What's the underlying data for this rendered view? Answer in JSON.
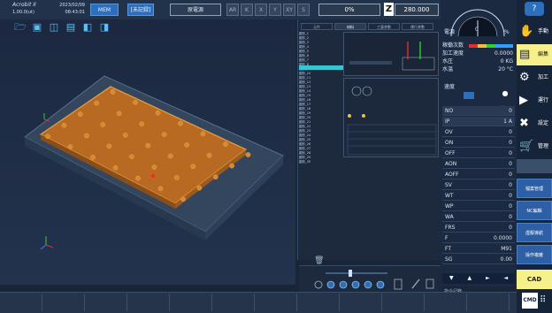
{
  "header": {
    "logo": "Acrobit II",
    "logo_sub": "1.00.0(ut)",
    "date": "2023/02/09",
    "time": "08:43:01",
    "mode_btn": "MEM",
    "disconnect_btn": "[未記録]",
    "status_btn": "原電源",
    "axis_btns": [
      "AR",
      "K",
      "X",
      "Y",
      "XY",
      "S"
    ],
    "progress": "0%",
    "z_label": "Z",
    "z_value": "280.000"
  },
  "gauge": {
    "left": "電源",
    "zero": "0",
    "unit": "%"
  },
  "status_block": {
    "label1": "稼働次数",
    "label2": "加工速度",
    "label2_val": "0.0000",
    "label3": "水圧",
    "label3_val": "0 KG",
    "label4": "水温",
    "label4_val": "20 °C",
    "label5": "速度"
  },
  "sidebar": [
    {
      "label": "手動",
      "icon": "hand-icon"
    },
    {
      "label": "編集",
      "icon": "document-icon"
    },
    {
      "label": "加工",
      "icon": "machine-icon"
    },
    {
      "label": "運行",
      "icon": "run-icon"
    },
    {
      "label": "設定",
      "icon": "tools-icon"
    },
    {
      "label": "管理",
      "icon": "cart-icon"
    }
  ],
  "side_bottom_btns": [
    "檔案管理",
    "NC編輯",
    "虛擬導航",
    "操作複雜"
  ],
  "cad_btn": "CAD",
  "cmd_btn": "CMD",
  "table_rows": [
    {
      "k": "NO",
      "v": "0"
    },
    {
      "k": "IP",
      "v": "1 A"
    },
    {
      "k": "OV",
      "v": "0"
    },
    {
      "k": "ON",
      "v": "0"
    },
    {
      "k": "OFF",
      "v": "0"
    },
    {
      "k": "AON",
      "v": "0"
    },
    {
      "k": "AOFF",
      "v": "0"
    },
    {
      "k": "SV",
      "v": "0"
    },
    {
      "k": "WT",
      "v": "0"
    },
    {
      "k": "WP",
      "v": "0"
    },
    {
      "k": "WA",
      "v": "0"
    },
    {
      "k": "FRS",
      "v": "0"
    },
    {
      "k": "F",
      "v": "0.0000"
    },
    {
      "k": "FT",
      "v": "M91"
    },
    {
      "k": "SG",
      "v": "0.00"
    }
  ],
  "mid_tabs": [
    "元件",
    "材料",
    "工藝參數",
    "運行參數"
  ],
  "tree_items": [
    "圖形_1",
    "圖形_2",
    "圖形_3",
    "圖形_4",
    "圖形_5",
    "圖形_6",
    "圖形_7",
    "圖形_8",
    "圖形_9",
    "圖形_10",
    "圖形_11",
    "圖形_12",
    "圖形_13",
    "圖形_14",
    "圖形_15",
    "圖形_16",
    "圖形_17",
    "圖形_18",
    "圖形_19",
    "圖形_20",
    "圖形_21",
    "圖形_22",
    "圖形_23",
    "圖形_24",
    "圖形_25",
    "圖形_26",
    "圖形_27",
    "圖形_28",
    "圖形_29",
    "圖形_30"
  ],
  "cmd_hint": "指令記錄",
  "colors": {
    "accent": "#2b6fbd",
    "highlight": "#35c6d6",
    "part": "#b86a22"
  }
}
